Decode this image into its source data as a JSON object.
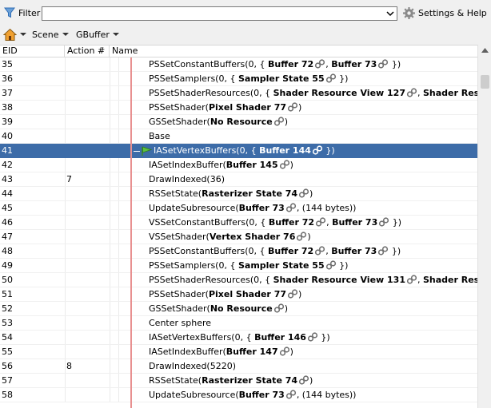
{
  "filter": {
    "label": "Filter",
    "value": "",
    "placeholder": ""
  },
  "settings": {
    "label": "Settings & Help"
  },
  "toolbar": {
    "scene_label": "Scene",
    "gbuffer_label": "GBuffer"
  },
  "columns": {
    "eid": "EID",
    "action": "Action #",
    "name": "Name"
  },
  "rows": [
    {
      "eid": "35",
      "action": "",
      "parts": [
        {
          "t": "PSSetConstantBuffers(0, { "
        },
        {
          "b": "Buffer 72"
        },
        {
          "link": true
        },
        {
          "t": ", "
        },
        {
          "b": "Buffer 73"
        },
        {
          "link": true
        },
        {
          "t": " })"
        }
      ]
    },
    {
      "eid": "36",
      "action": "",
      "parts": [
        {
          "t": "PSSetSamplers(0, { "
        },
        {
          "b": "Sampler State 55"
        },
        {
          "link": true
        },
        {
          "t": " })"
        }
      ]
    },
    {
      "eid": "37",
      "action": "",
      "parts": [
        {
          "t": "PSSetShaderResources(0, { "
        },
        {
          "b": "Shader Resource View 127"
        },
        {
          "link": true
        },
        {
          "t": ", "
        },
        {
          "b": "Shader Resource"
        }
      ]
    },
    {
      "eid": "38",
      "action": "",
      "parts": [
        {
          "t": "PSSetShader("
        },
        {
          "b": "Pixel Shader 77"
        },
        {
          "link": true
        },
        {
          "t": ")"
        }
      ]
    },
    {
      "eid": "39",
      "action": "",
      "parts": [
        {
          "t": "GSSetShader("
        },
        {
          "b": "No Resource"
        },
        {
          "link": true
        },
        {
          "t": ")"
        }
      ]
    },
    {
      "eid": "40",
      "action": "",
      "parts": [
        {
          "t": "Base"
        }
      ]
    },
    {
      "eid": "41",
      "action": "",
      "selected": true,
      "parts": [
        {
          "t": "IASetVertexBuffers(0, { "
        },
        {
          "b": "Buffer 144"
        },
        {
          "link": true
        },
        {
          "t": " })"
        }
      ]
    },
    {
      "eid": "42",
      "action": "",
      "parts": [
        {
          "t": "IASetIndexBuffer("
        },
        {
          "b": "Buffer 145"
        },
        {
          "link": true
        },
        {
          "t": ")"
        }
      ]
    },
    {
      "eid": "43",
      "action": "7",
      "parts": [
        {
          "t": "DrawIndexed(36)"
        }
      ]
    },
    {
      "eid": "44",
      "action": "",
      "parts": [
        {
          "t": "RSSetState("
        },
        {
          "b": "Rasterizer State 74"
        },
        {
          "link": true
        },
        {
          "t": ")"
        }
      ]
    },
    {
      "eid": "45",
      "action": "",
      "parts": [
        {
          "t": "UpdateSubresource("
        },
        {
          "b": "Buffer 73"
        },
        {
          "link": true
        },
        {
          "t": ", (144 bytes))"
        }
      ]
    },
    {
      "eid": "46",
      "action": "",
      "parts": [
        {
          "t": "VSSetConstantBuffers(0, { "
        },
        {
          "b": "Buffer 72"
        },
        {
          "link": true
        },
        {
          "t": ", "
        },
        {
          "b": "Buffer 73"
        },
        {
          "link": true
        },
        {
          "t": " })"
        }
      ]
    },
    {
      "eid": "47",
      "action": "",
      "parts": [
        {
          "t": "VSSetShader("
        },
        {
          "b": "Vertex Shader 76"
        },
        {
          "link": true
        },
        {
          "t": ")"
        }
      ]
    },
    {
      "eid": "48",
      "action": "",
      "parts": [
        {
          "t": "PSSetConstantBuffers(0, { "
        },
        {
          "b": "Buffer 72"
        },
        {
          "link": true
        },
        {
          "t": ", "
        },
        {
          "b": "Buffer 73"
        },
        {
          "link": true
        },
        {
          "t": " })"
        }
      ]
    },
    {
      "eid": "49",
      "action": "",
      "parts": [
        {
          "t": "PSSetSamplers(0, { "
        },
        {
          "b": "Sampler State 55"
        },
        {
          "link": true
        },
        {
          "t": " })"
        }
      ]
    },
    {
      "eid": "50",
      "action": "",
      "parts": [
        {
          "t": "PSSetShaderResources(0, { "
        },
        {
          "b": "Shader Resource View 131"
        },
        {
          "link": true
        },
        {
          "t": ", "
        },
        {
          "b": "Shader Resource"
        }
      ]
    },
    {
      "eid": "51",
      "action": "",
      "parts": [
        {
          "t": "PSSetShader("
        },
        {
          "b": "Pixel Shader 77"
        },
        {
          "link": true
        },
        {
          "t": ")"
        }
      ]
    },
    {
      "eid": "52",
      "action": "",
      "parts": [
        {
          "t": "GSSetShader("
        },
        {
          "b": "No Resource"
        },
        {
          "link": true
        },
        {
          "t": ")"
        }
      ]
    },
    {
      "eid": "53",
      "action": "",
      "parts": [
        {
          "t": "Center sphere"
        }
      ]
    },
    {
      "eid": "54",
      "action": "",
      "parts": [
        {
          "t": "IASetVertexBuffers(0, { "
        },
        {
          "b": "Buffer 146"
        },
        {
          "link": true
        },
        {
          "t": " })"
        }
      ]
    },
    {
      "eid": "55",
      "action": "",
      "parts": [
        {
          "t": "IASetIndexBuffer("
        },
        {
          "b": "Buffer 147"
        },
        {
          "link": true
        },
        {
          "t": ")"
        }
      ]
    },
    {
      "eid": "56",
      "action": "8",
      "parts": [
        {
          "t": "DrawIndexed(5220)"
        }
      ]
    },
    {
      "eid": "57",
      "action": "",
      "parts": [
        {
          "t": "RSSetState("
        },
        {
          "b": "Rasterizer State 74"
        },
        {
          "link": true
        },
        {
          "t": ")"
        }
      ]
    },
    {
      "eid": "58",
      "action": "",
      "parts": [
        {
          "t": "UpdateSubresource("
        },
        {
          "b": "Buffer 73"
        },
        {
          "link": true
        },
        {
          "t": ", (144 bytes))"
        }
      ]
    }
  ]
}
